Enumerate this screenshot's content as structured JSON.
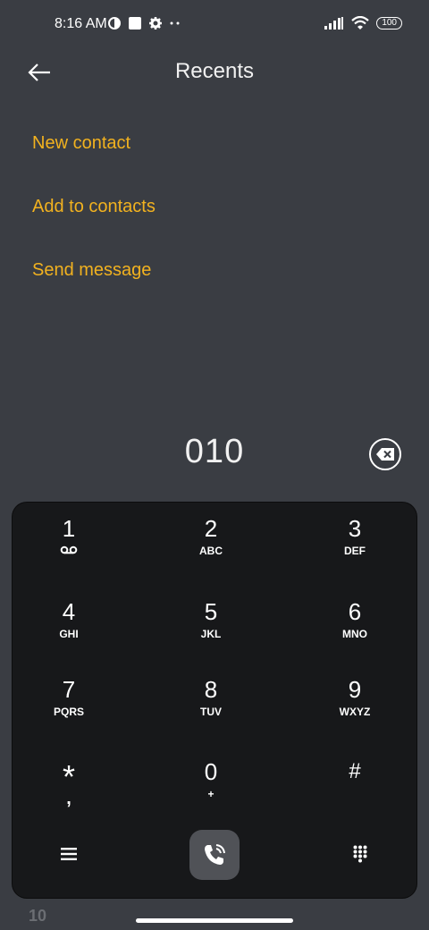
{
  "status": {
    "time": "8:16 AM",
    "battery": "100"
  },
  "header": {
    "title": "Recents"
  },
  "menu": {
    "items": [
      {
        "label": "New contact"
      },
      {
        "label": "Add to contacts"
      },
      {
        "label": "Send message"
      }
    ]
  },
  "dialer": {
    "number": "010"
  },
  "keypad": {
    "keys": [
      {
        "digit": "1",
        "letters": ""
      },
      {
        "digit": "2",
        "letters": "ABC"
      },
      {
        "digit": "3",
        "letters": "DEF"
      },
      {
        "digit": "4",
        "letters": "GHI"
      },
      {
        "digit": "5",
        "letters": "JKL"
      },
      {
        "digit": "6",
        "letters": "MNO"
      },
      {
        "digit": "7",
        "letters": "PQRS"
      },
      {
        "digit": "8",
        "letters": "TUV"
      },
      {
        "digit": "9",
        "letters": "WXYZ"
      },
      {
        "digit": "*",
        "letters": ","
      },
      {
        "digit": "0",
        "letters": "+"
      },
      {
        "digit": "#",
        "letters": ""
      }
    ]
  },
  "peek_text": "10",
  "colors": {
    "accent": "#f2b21f",
    "background": "#3a3d43",
    "keypad": "#17181a"
  }
}
